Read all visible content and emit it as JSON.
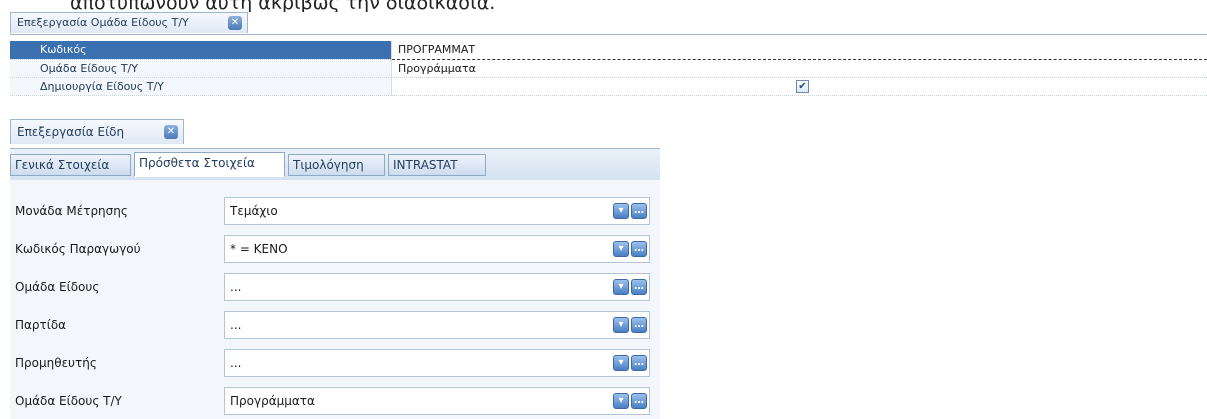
{
  "header_text": "αποτυπώνουν αυτή ακριβώς την διαδικασία.",
  "group_panel": {
    "tab_label": "Επεξεργασία Ομάδα Είδους Τ/Υ",
    "rows": [
      {
        "label": "Κωδικός",
        "value": "ΠΡΟΓΡΑΜΜΑΤ"
      },
      {
        "label": "Ομάδα Είδους Τ/Υ",
        "value": "Προγράμματα"
      },
      {
        "label": "Δημιουργία Είδους Τ/Υ",
        "value": ""
      }
    ],
    "create_checked": true
  },
  "items_panel": {
    "tab_label": "Επεξεργασία Είδη",
    "subtabs": [
      "Γενικά Στοιχεία",
      "Πρόσθετα Στοιχεία",
      "Τιμολόγηση",
      "INTRASTAT"
    ],
    "active_subtab": "Πρόσθετα Στοιχεία",
    "fields": [
      {
        "label": "Μονάδα Μέτρησης",
        "value": "Τεμάχιο"
      },
      {
        "label": "Κωδικός Παραγωγού",
        "value": "* = ΚΕΝΟ"
      },
      {
        "label": "Ομάδα Είδους",
        "value": "..."
      },
      {
        "label": "Παρτίδα",
        "value": "..."
      },
      {
        "label": "Προμηθευτής",
        "value": "..."
      },
      {
        "label": "Ομάδα Είδους Τ/Υ",
        "value": "Προγράμματα"
      }
    ]
  },
  "icons": {
    "close": "close-icon",
    "dropdown": "chevron-down-icon",
    "more": "ellipsis-icon",
    "check": "check-icon"
  },
  "colors": {
    "selection": "#3a6fb0",
    "tab_border": "#9fb6cf",
    "button": "#4a7fc4"
  }
}
